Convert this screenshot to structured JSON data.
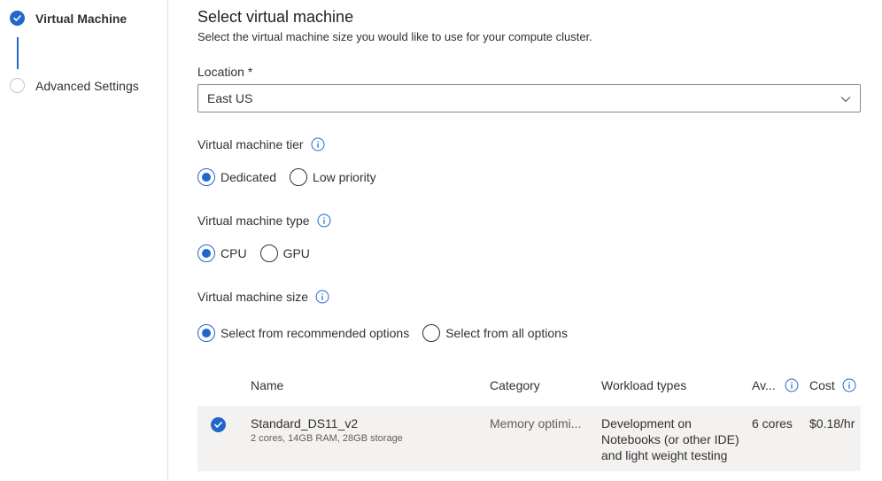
{
  "stepper": {
    "steps": [
      {
        "label": "Virtual Machine",
        "state": "done"
      },
      {
        "label": "Advanced Settings",
        "state": "todo"
      }
    ]
  },
  "page": {
    "title": "Select virtual machine",
    "subtitle": "Select the virtual machine size you would like to use for your compute cluster."
  },
  "location": {
    "label": "Location *",
    "value": "East US"
  },
  "tier": {
    "label": "Virtual machine tier",
    "options": [
      {
        "label": "Dedicated",
        "checked": true
      },
      {
        "label": "Low priority",
        "checked": false
      }
    ]
  },
  "vm_type": {
    "label": "Virtual machine type",
    "options": [
      {
        "label": "CPU",
        "checked": true
      },
      {
        "label": "GPU",
        "checked": false
      }
    ]
  },
  "vm_size": {
    "label": "Virtual machine size",
    "options": [
      {
        "label": "Select from recommended options",
        "checked": true
      },
      {
        "label": "Select from all options",
        "checked": false
      }
    ]
  },
  "table": {
    "columns": [
      "Name",
      "Category",
      "Workload types",
      "Av...",
      "Cost"
    ],
    "rows": [
      {
        "name": "Standard_DS11_v2",
        "specs": "2 cores, 14GB RAM, 28GB storage",
        "category": "Memory optimi...",
        "workload": "Development on Notebooks (or other IDE) and light weight testing",
        "available": "6 cores",
        "cost": "$0.18/hr",
        "selected": true
      }
    ]
  },
  "colors": {
    "accent": "#2266cc",
    "row_bg": "#f3f2f1",
    "divider": "#e1dfdd"
  },
  "icons": [
    "check-circle-icon",
    "empty-circle-icon",
    "chevron-down-icon",
    "info-icon"
  ]
}
